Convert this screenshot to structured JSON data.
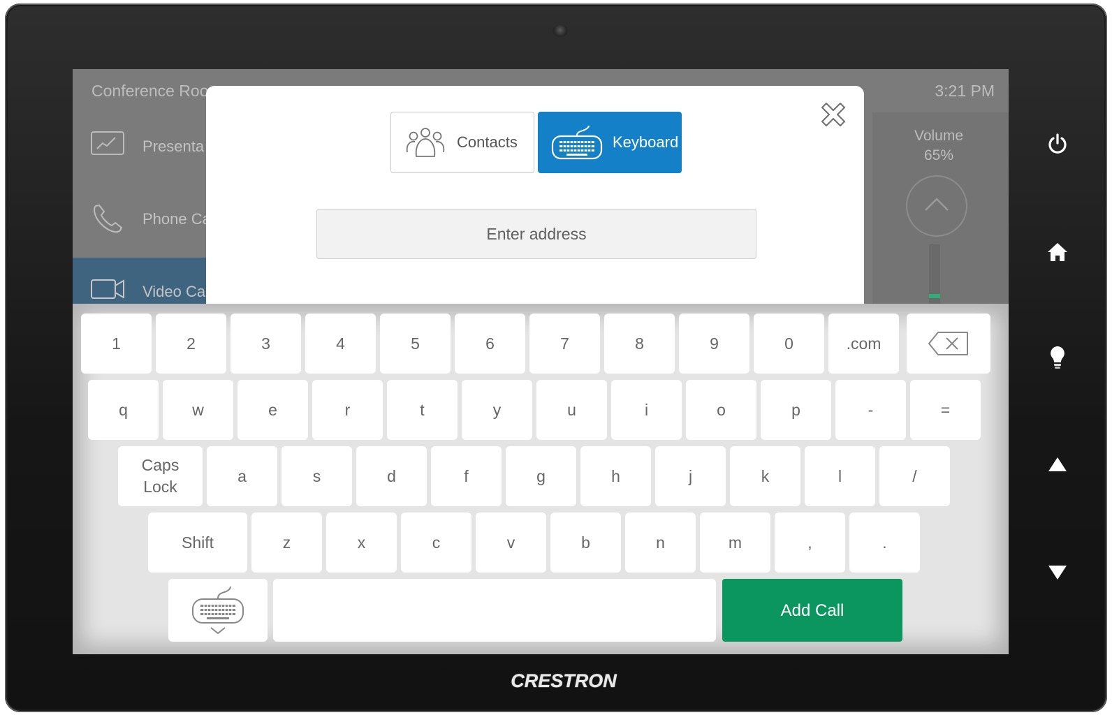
{
  "device": {
    "brand": "CRESTRON",
    "buttons": [
      {
        "name": "power-icon"
      },
      {
        "name": "home-icon"
      },
      {
        "name": "lightbulb-icon"
      },
      {
        "name": "arrow-up-icon"
      },
      {
        "name": "arrow-down-icon"
      }
    ]
  },
  "background": {
    "room_title": "Conference Roo",
    "time": "3:21 PM",
    "nav": [
      {
        "label": "Presenta",
        "icon": "presentation-icon"
      },
      {
        "label": "Phone Ca",
        "icon": "phone-icon"
      },
      {
        "label": "Video Ca",
        "icon": "video-camera-icon",
        "active": true
      }
    ],
    "volume": {
      "label": "Volume",
      "value": "65%",
      "level": 0.65
    }
  },
  "modal": {
    "tabs": [
      {
        "label": "Contacts",
        "icon": "contacts-icon",
        "selected": false
      },
      {
        "label": "Keyboard",
        "icon": "keyboard-icon",
        "selected": true
      }
    ],
    "address": {
      "value": "",
      "placeholder": "Enter address"
    }
  },
  "keyboard": {
    "row1": [
      "1",
      "2",
      "3",
      "4",
      "5",
      "6",
      "7",
      "8",
      "9",
      "0",
      ".com"
    ],
    "row2": [
      "q",
      "w",
      "e",
      "r",
      "t",
      "y",
      "u",
      "i",
      "o",
      "p",
      "-",
      "="
    ],
    "row3": [
      "Caps\nLock",
      "a",
      "s",
      "d",
      "f",
      "g",
      "h",
      "j",
      "k",
      "l",
      "/"
    ],
    "row4": [
      "Shift",
      "z",
      "x",
      "c",
      "v",
      "b",
      "n",
      "m",
      ",",
      "."
    ],
    "add_call": "Add Call",
    "colors": {
      "accent_blue": "#1480c8",
      "add_call_green": "#0b9660"
    }
  }
}
